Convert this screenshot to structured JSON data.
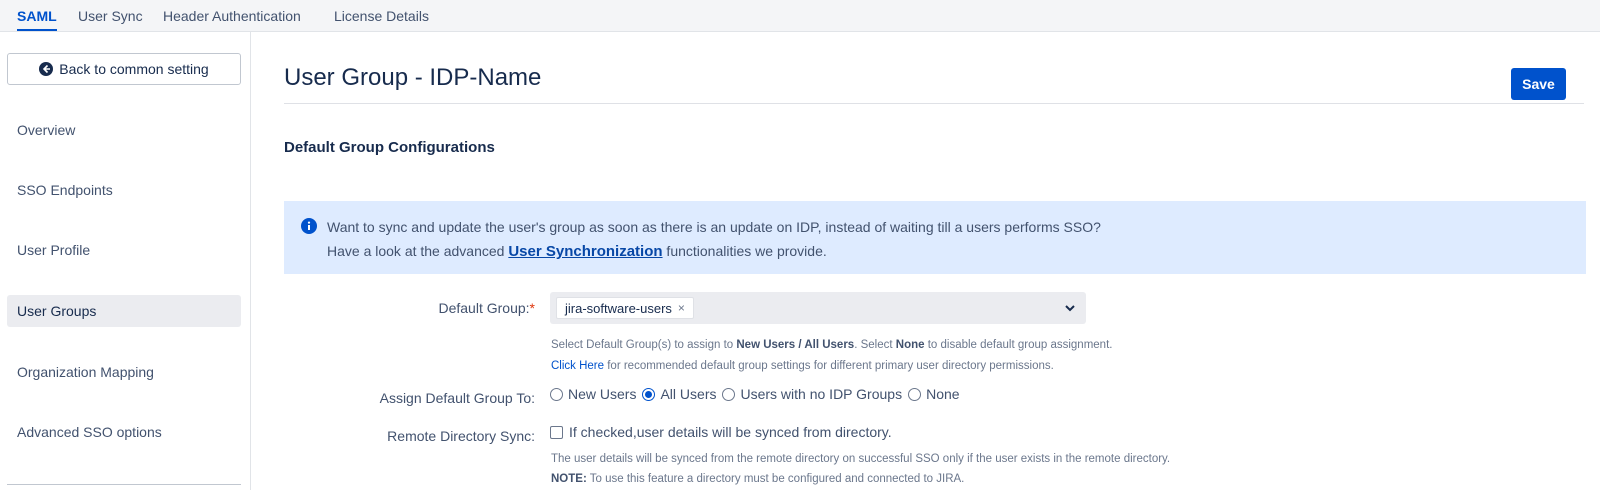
{
  "tabs": [
    {
      "label": "SAML",
      "active": true
    },
    {
      "label": "User Sync",
      "active": false
    },
    {
      "label": "Header Authentication",
      "active": false
    },
    {
      "label": "License Details",
      "active": false
    }
  ],
  "sidebar": {
    "back_label": "Back to common setting",
    "items": [
      {
        "label": "Overview"
      },
      {
        "label": "SSO Endpoints"
      },
      {
        "label": "User Profile"
      },
      {
        "label": "User Groups"
      },
      {
        "label": "Organization Mapping"
      },
      {
        "label": "Advanced SSO options"
      }
    ]
  },
  "main": {
    "title": "User Group - IDP-Name",
    "save_label": "Save",
    "section_title": "Default Group Configurations",
    "info": {
      "line1": "Want to sync and update the user's group as soon as there is an update on IDP, instead of waiting till a users performs SSO?",
      "line2_pre": "Have a look at the advanced ",
      "line2_link": "User Synchronization",
      "line2_post": " functionalities we provide."
    },
    "default_group": {
      "label": "Default Group:",
      "required_mark": "*",
      "chip": "jira-software-users",
      "chip_remove": "×",
      "help1_a": "Select Default Group(s) to assign to ",
      "help1_b": "New Users / All Users",
      "help1_c": ". Select ",
      "help1_d": "None",
      "help1_e": " to disable default group assignment.",
      "help2_link": "Click Here",
      "help2_rest": " for recommended default group settings for different primary user directory permissions."
    },
    "assign_to": {
      "label": "Assign Default Group To:",
      "options": [
        {
          "label": "New Users",
          "checked": false
        },
        {
          "label": "All Users",
          "checked": true
        },
        {
          "label": "Users with no IDP Groups",
          "checked": false
        },
        {
          "label": "None",
          "checked": false
        }
      ]
    },
    "remote_sync": {
      "label": "Remote Directory Sync:",
      "checkbox_label": "If checked,user details will be synced from directory.",
      "help1": "The user details will be synced from the remote directory on successful SSO only if the user exists in the remote directory.",
      "help2_bold": "NOTE:",
      "help2_rest": " To use this feature a directory must be configured and connected to JIRA."
    }
  },
  "colors": {
    "accent": "#0052cc",
    "info_bg": "#deebff",
    "required": "#de350b"
  }
}
